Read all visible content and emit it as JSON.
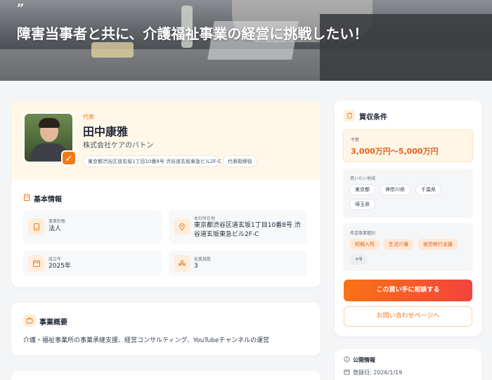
{
  "hero": {
    "quote_mark": "”",
    "title": "障害当事者と共に、介護福祉事業の経営に挑戦したい！"
  },
  "profile": {
    "role": "代表",
    "name": "田中康雅",
    "company": "株式会社ケアのバトン",
    "address_tag": "東京都渋谷区道玄坂1丁目10番8号 渋谷道玄坂東急ビル2F-C",
    "title_tag": "代表取締役",
    "check_glyph": "✓"
  },
  "basic_info": {
    "title": "基本情報",
    "items": [
      {
        "label": "事業形態",
        "value": "法人",
        "icon": "building-icon"
      },
      {
        "label": "本社所在地",
        "value": "東京都渋谷区道玄坂1丁目10番8号 渋谷道玄坂東急ビル2F-C",
        "icon": "location-pin-icon"
      },
      {
        "label": "設立年",
        "value": "2025年",
        "icon": "calendar-icon"
      },
      {
        "label": "従業員数",
        "value": "3",
        "icon": "people-icon"
      }
    ]
  },
  "summary": {
    "title": "事業概要",
    "text": "介護・福祉事業所の事業承継支援、経営コンサルティング、YouTubeチャンネルの運営"
  },
  "conditions": {
    "title": "買収条件",
    "budget_label": "予算",
    "budget_value": "3,000万円〜5,000万円",
    "regions_label": "買いたい地域",
    "regions": [
      "東京都",
      "神奈川県",
      "千葉県",
      "埼玉県"
    ],
    "types_label": "希望事業種別",
    "types": [
      "短期入所",
      "生活介護",
      "就労移行支援"
    ],
    "types_more": "+9",
    "consult_button": "この買い手に相談する",
    "contact_button": "お問い合わせページへ"
  },
  "public_info": {
    "title": "公開情報",
    "registered": "登録日: 2026/1/19"
  },
  "colors": {
    "accent": "#ef7a1b",
    "accent_dark": "#e5621b",
    "gradient_end": "#f2433d"
  }
}
